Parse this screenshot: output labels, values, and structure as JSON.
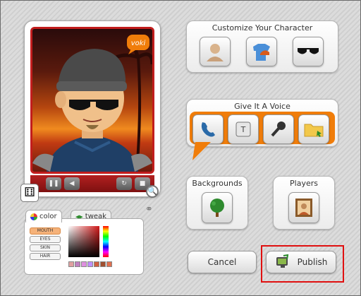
{
  "customize": {
    "title": "Customize Your Character",
    "buttons": [
      {
        "name": "head-button",
        "icon": "person-icon"
      },
      {
        "name": "clothing-button",
        "icon": "shirt-cap-icon"
      },
      {
        "name": "accessories-button",
        "icon": "sunglasses-icon"
      }
    ]
  },
  "voice": {
    "title": "Give It A Voice",
    "buttons": [
      {
        "name": "phone-voice-button",
        "icon": "phone-icon"
      },
      {
        "name": "text-voice-button",
        "icon": "keyboard-key-icon"
      },
      {
        "name": "mic-voice-button",
        "icon": "microphone-icon"
      },
      {
        "name": "upload-voice-button",
        "icon": "folder-icon"
      }
    ]
  },
  "backgrounds": {
    "title": "Backgrounds",
    "icon": "tree-icon"
  },
  "players": {
    "title": "Players",
    "icon": "picture-frame-icon"
  },
  "actions": {
    "cancel": "Cancel",
    "publish": "Publish"
  },
  "character": {
    "logo": "voki"
  },
  "color_panel": {
    "tab_color": "color",
    "tab_tweak": "tweak",
    "parts": [
      "MOUTH",
      "EYES",
      "SKIN",
      "HAIR"
    ],
    "active_part": "MOUTH",
    "swatches": [
      "#e0a0a0",
      "#c080c0",
      "#e090e0",
      "#c090ff",
      "#d06040",
      "#a05030",
      "#e07050"
    ]
  },
  "colors": {
    "accent_orange": "#f07d0a",
    "highlight_red": "#e01010",
    "frame_red": "#c21d1d"
  }
}
